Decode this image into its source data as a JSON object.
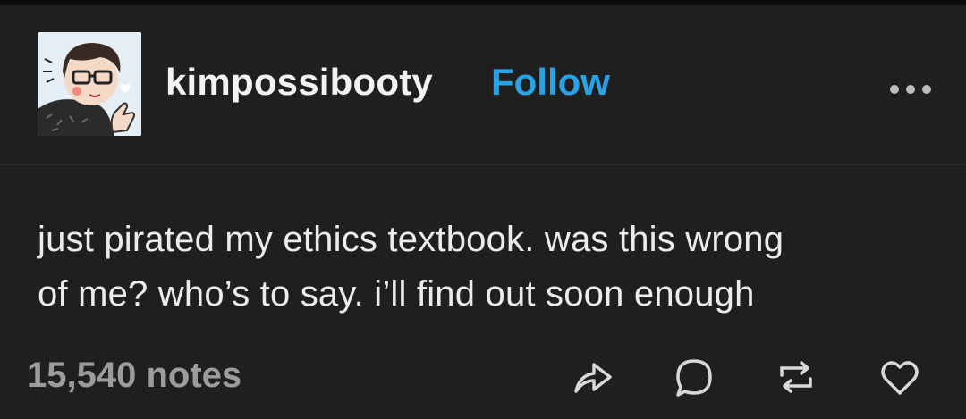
{
  "post": {
    "username": "kimpossibooty",
    "follow_label": "Follow",
    "body_lines": [
      "just pirated my ethics textbook. was this wrong",
      "of me? who’s to say. i’ll find out soon enough"
    ],
    "notes": "15,540 notes",
    "more_icon": "ellipsis-icon",
    "actions": [
      "share-icon",
      "reply-icon",
      "reblog-icon",
      "like-icon"
    ]
  },
  "colors": {
    "background": "#1f1f1f",
    "accent": "#27a3e6",
    "muted": "#9c9c9c"
  }
}
